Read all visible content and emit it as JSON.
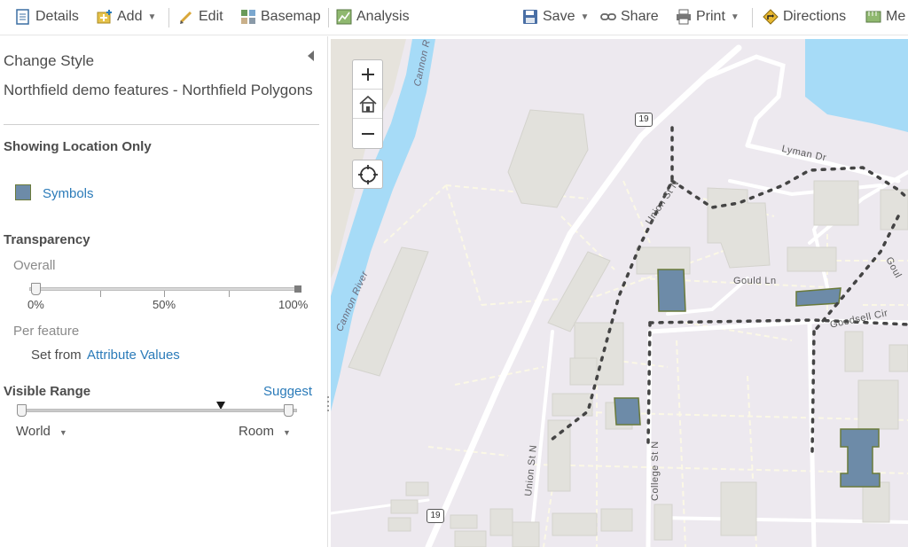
{
  "toolbar": {
    "details": "Details",
    "add": "Add",
    "edit": "Edit",
    "basemap": "Basemap",
    "analysis": "Analysis",
    "save": "Save",
    "share": "Share",
    "print": "Print",
    "directions": "Directions",
    "measure": "Me"
  },
  "panel": {
    "title": "Change Style",
    "layer_name": "Northfield demo features - Northfield Polygons",
    "showing": "Showing Location Only",
    "symbols_link": "Symbols",
    "symbol_color": "#6d8ba8",
    "transparency_heading": "Transparency",
    "overall_label": "Overall",
    "overall_ticks": [
      "0%",
      "50%",
      "100%"
    ],
    "overall_value_percent": 0,
    "per_feature_label": "Per feature",
    "set_from_text": "Set from",
    "attribute_values_link": "Attribute Values",
    "visible_range_heading": "Visible Range",
    "suggest_link": "Suggest",
    "range_min": "World",
    "range_max": "Room"
  },
  "map": {
    "labels": {
      "cannon_river_top": "Cannon R",
      "cannon_river_left": "Cannon River",
      "lyman_dr": "Lyman Dr",
      "union_st_top": "Union St N",
      "union_st_bottom": "Union St N",
      "gould_ln": "Gould Ln",
      "goodsell_cir": "Goodsell Cir",
      "college_st": "College St N",
      "gould_right": "Goul"
    },
    "route_shields": [
      "19",
      "19"
    ],
    "colors": {
      "land": "#ede9ef",
      "water": "#a6dbf7",
      "building": "#e2e1dc",
      "feature_fill": "#6d8ba8",
      "feature_outline": "#6a7a3a"
    }
  }
}
